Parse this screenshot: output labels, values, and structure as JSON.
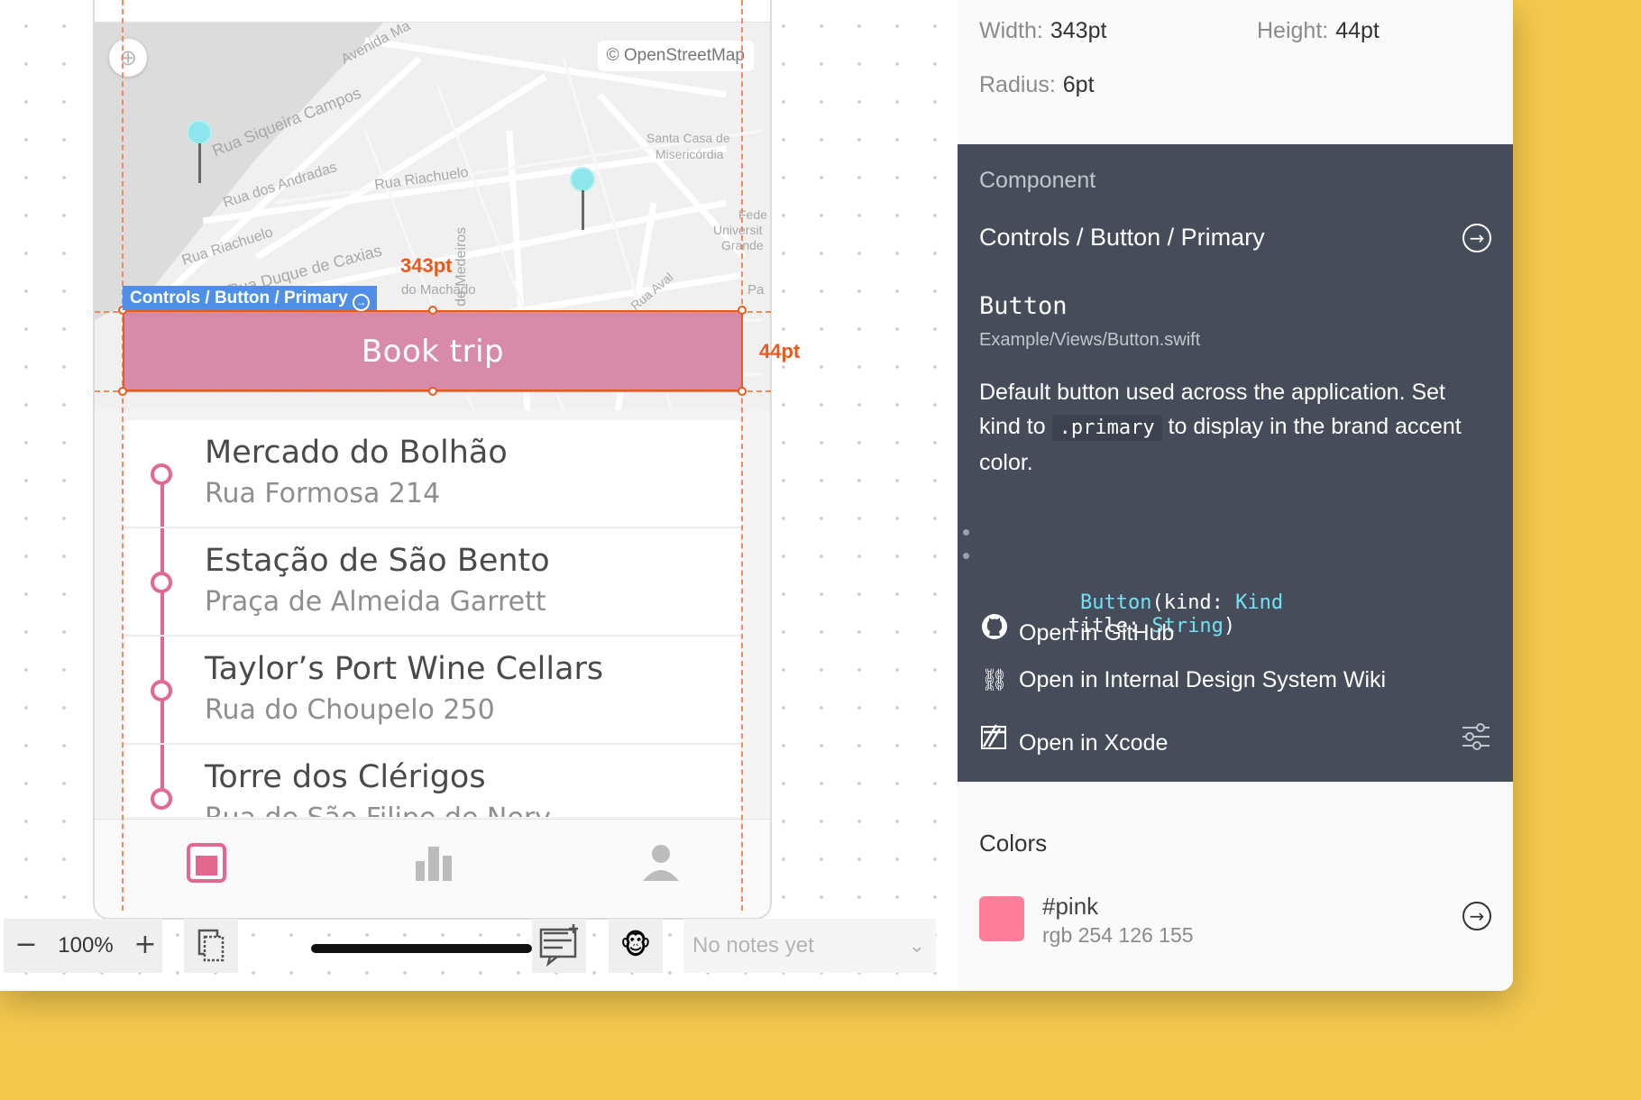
{
  "canvas": {
    "map": {
      "attribution": "© OpenStreetMap",
      "streets": [
        "Avenida Ma",
        "Rua Siqueira Campos",
        "Rua dos Andradas",
        "Rua Riachuelo",
        "Rua Riachuelo",
        "Rua Duque de Caxias",
        "Borges de Medeiros",
        "Santa Casa de",
        "Misericórdia",
        "Fede",
        "Universit",
        "Grande",
        "Rua Aval",
        "do Machado",
        "Pa"
      ]
    },
    "selected_component_tag": "Controls / Button / Primary",
    "width_measure": "343pt",
    "height_measure": "44pt",
    "primary_button_label": "Book trip",
    "stops": [
      {
        "name": "Mercado do Bolhão",
        "address": "Rua Formosa 214"
      },
      {
        "name": "Estação de São Bento",
        "address": "Praça de Almeida Garrett"
      },
      {
        "name": "Taylor’s Port Wine Cellars",
        "address": "Rua do Choupelo 250"
      },
      {
        "name": "Torre dos Clérigos",
        "address": "Rua de São Filipe de Nery"
      }
    ],
    "tabs": [
      "trips-icon",
      "stats-icon",
      "profile-icon"
    ]
  },
  "toolbar": {
    "zoom_minus": "−",
    "zoom_value": "100%",
    "zoom_plus": "+",
    "notes_placeholder": "No notes yet",
    "monkey_emoji": "🐵"
  },
  "inspector": {
    "width_label": "Width:",
    "width_value": "343pt",
    "height_label": "Height:",
    "height_value": "44pt",
    "radius_label": "Radius:",
    "radius_value": "6pt",
    "component": {
      "heading": "Component",
      "path": "Controls / Button / Primary",
      "name": "Button",
      "file": "Example/Views/Button.swift",
      "desc_1": "Default button used across the application. Set kind to",
      "desc_code": ".primary",
      "desc_2": "to display in the brand accent color.",
      "code_fn": "Button",
      "code_p1": "(kind: ",
      "code_t1": "Kind",
      "code_p2": "       title: ",
      "code_t2": "String",
      "code_end": ")",
      "links": {
        "github": "Open in GitHub",
        "wiki": "Open in Internal Design System Wiki",
        "xcode": "Open in Xcode"
      }
    },
    "colors": {
      "heading": "Colors",
      "name": "#pink",
      "rgb": "rgb 254 126 155",
      "swatch_hex": "#FE7E9B"
    }
  },
  "colors": {
    "background": "#F5C94E",
    "button_pink": "#D88BA8",
    "timeline_pink": "#E2688F",
    "measure_orange": "#E65B1F",
    "tag_blue": "#4F8FE6",
    "panel_dark": "#474C5B",
    "code_cyan": "#6EE4F4"
  }
}
